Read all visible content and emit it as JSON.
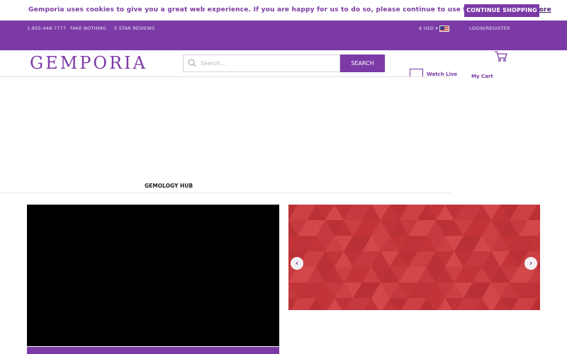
{
  "cookie_banner": {
    "message": "Gemporia uses cookies to give you a great web experience. If you are happy for us to do so, please continue to use this site.",
    "link_label": "Find out more",
    "button_label": "CONTINUE SHOPPING"
  },
  "topbar": {
    "phone": "1-855-448-7777",
    "fake_nothing": "FAKE NOTHING",
    "reviews": "5 STAR REVIEWS",
    "currency": "$ USD ▾",
    "login": "LOGIN/REGISTER"
  },
  "header": {
    "logo": "GEMPORIA",
    "search_placeholder": "Search...",
    "search_button": "SEARCH",
    "watch_live": "Watch Live",
    "cart": "My Cart"
  },
  "hub": {
    "label": "GEMOLOGY HUB"
  },
  "carousel": {
    "prev_icon": "‹",
    "next_icon": "›"
  },
  "colors": {
    "brand_purple": "#7b3aa6",
    "carousel_red": "#c7393e"
  }
}
